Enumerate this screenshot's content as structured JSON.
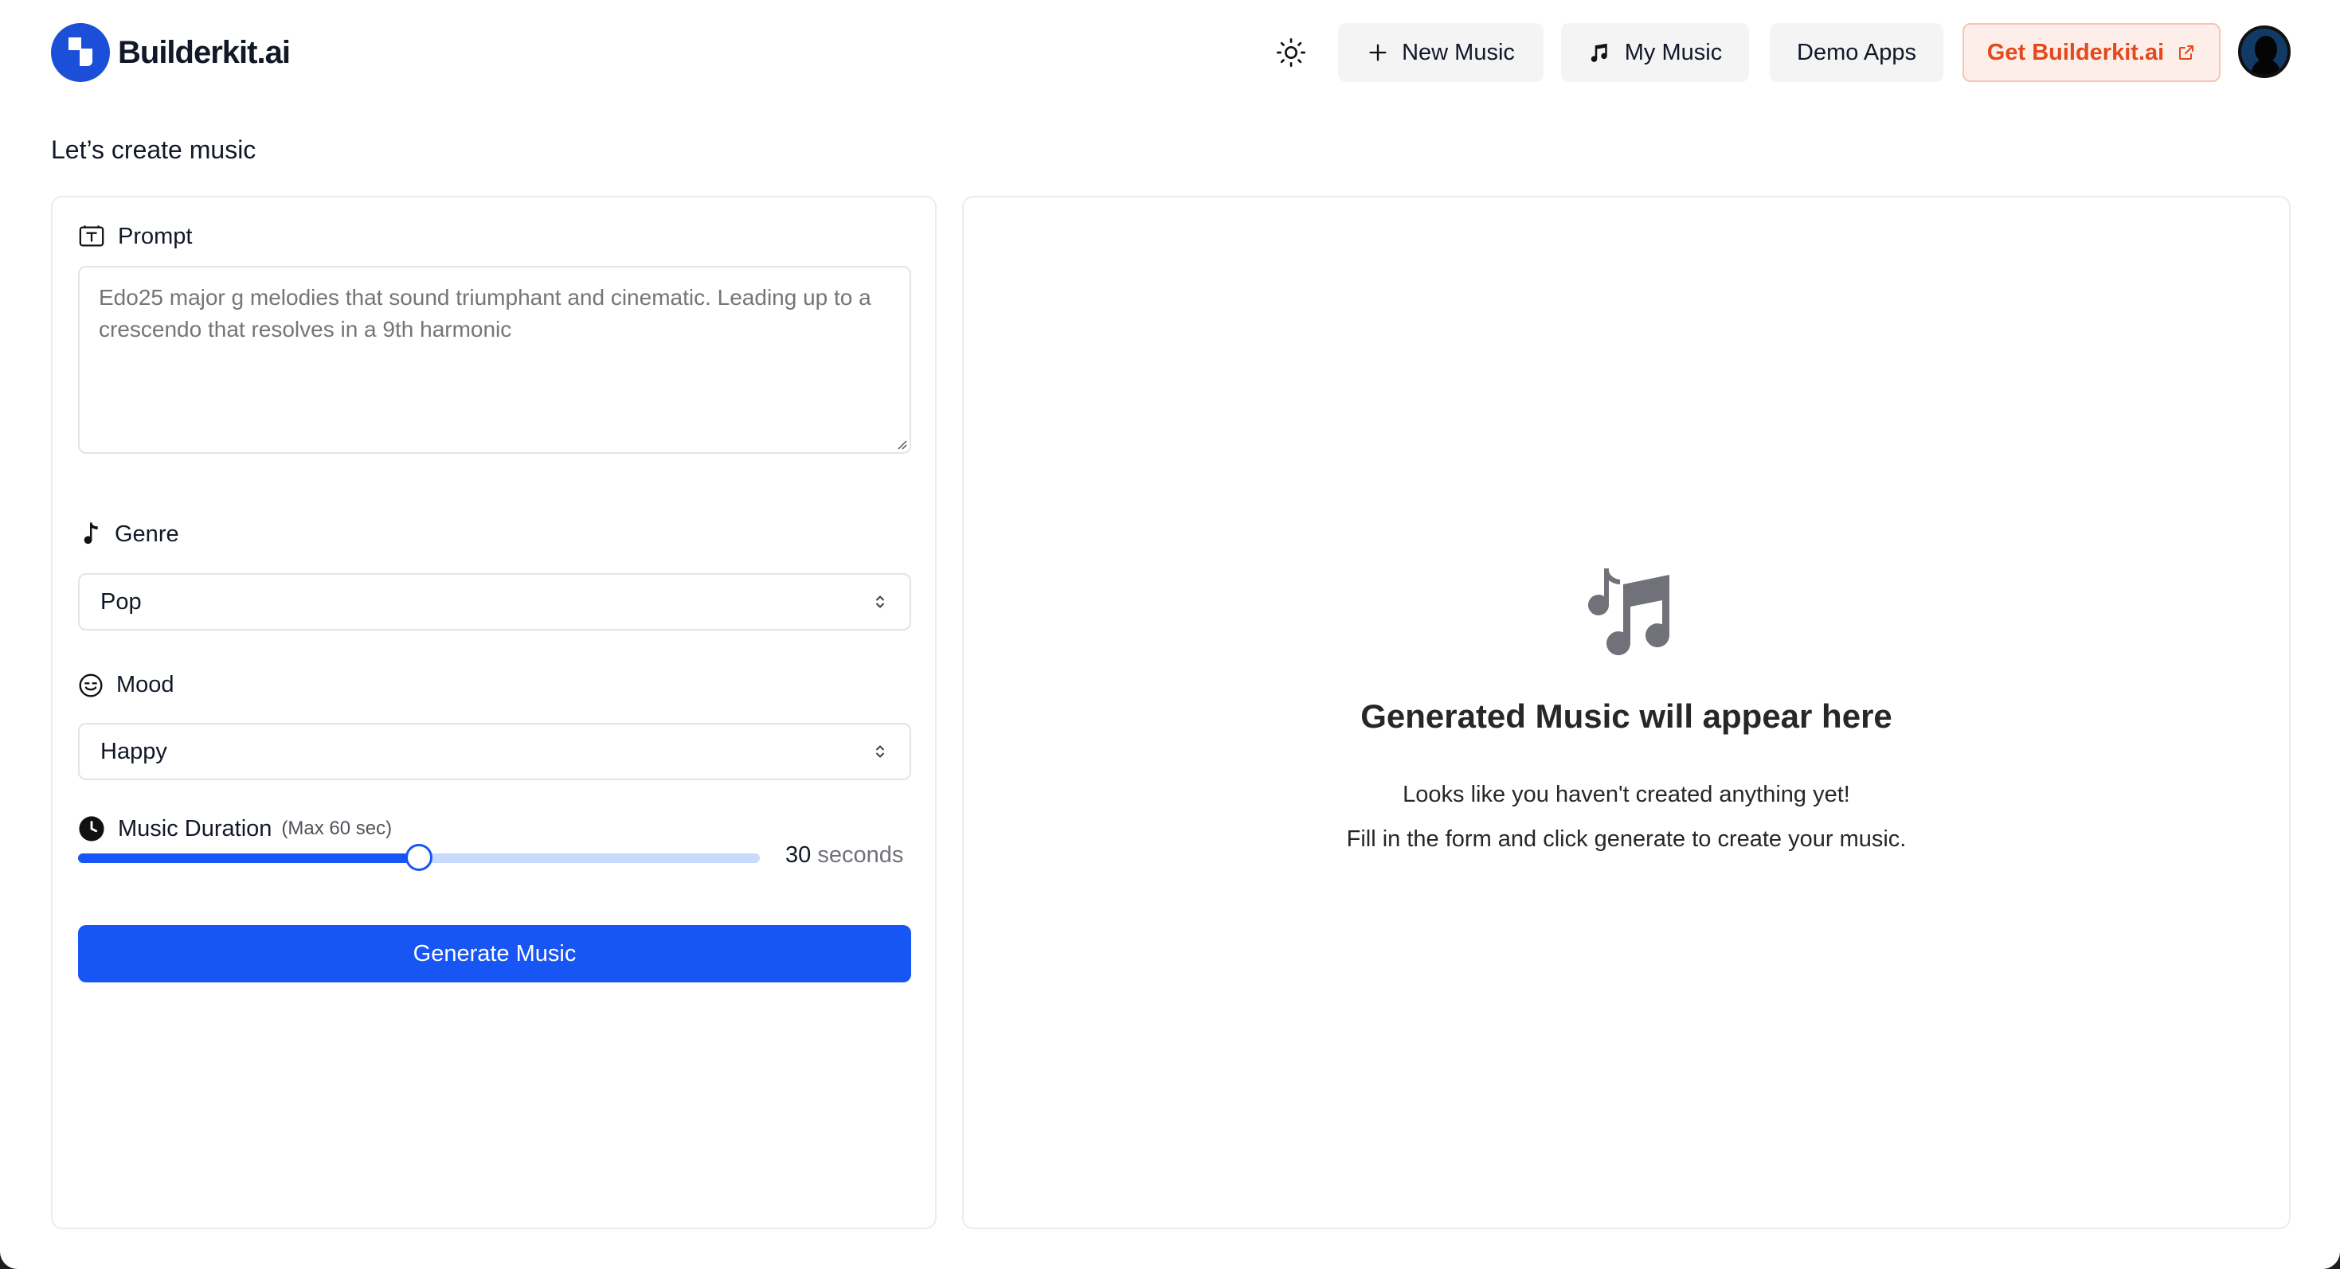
{
  "brand": {
    "name": "Builderkit.ai",
    "accent": "#1755f4"
  },
  "nav": {
    "theme_icon": "sun-icon",
    "new_music": "New Music",
    "my_music": "My Music",
    "demo_apps": "Demo Apps",
    "get_builderkit": "Get Builderkit.ai"
  },
  "page": {
    "title": "Let’s create music"
  },
  "form": {
    "prompt": {
      "label": "Prompt",
      "placeholder": "Edo25 major g melodies that sound triumphant and cinematic. Leading up to a crescendo that resolves in a 9th harmonic",
      "value": ""
    },
    "genre": {
      "label": "Genre",
      "value": "Pop"
    },
    "mood": {
      "label": "Mood",
      "value": "Happy"
    },
    "duration": {
      "label": "Music Duration",
      "hint": "(Max 60 sec)",
      "value": "30",
      "unit": "seconds",
      "max": 60
    },
    "submit": "Generate Music"
  },
  "output": {
    "title": "Generated Music will appear here",
    "line1": "Looks like you haven't created anything yet!",
    "line2": "Fill in the form and click generate to create your music."
  }
}
